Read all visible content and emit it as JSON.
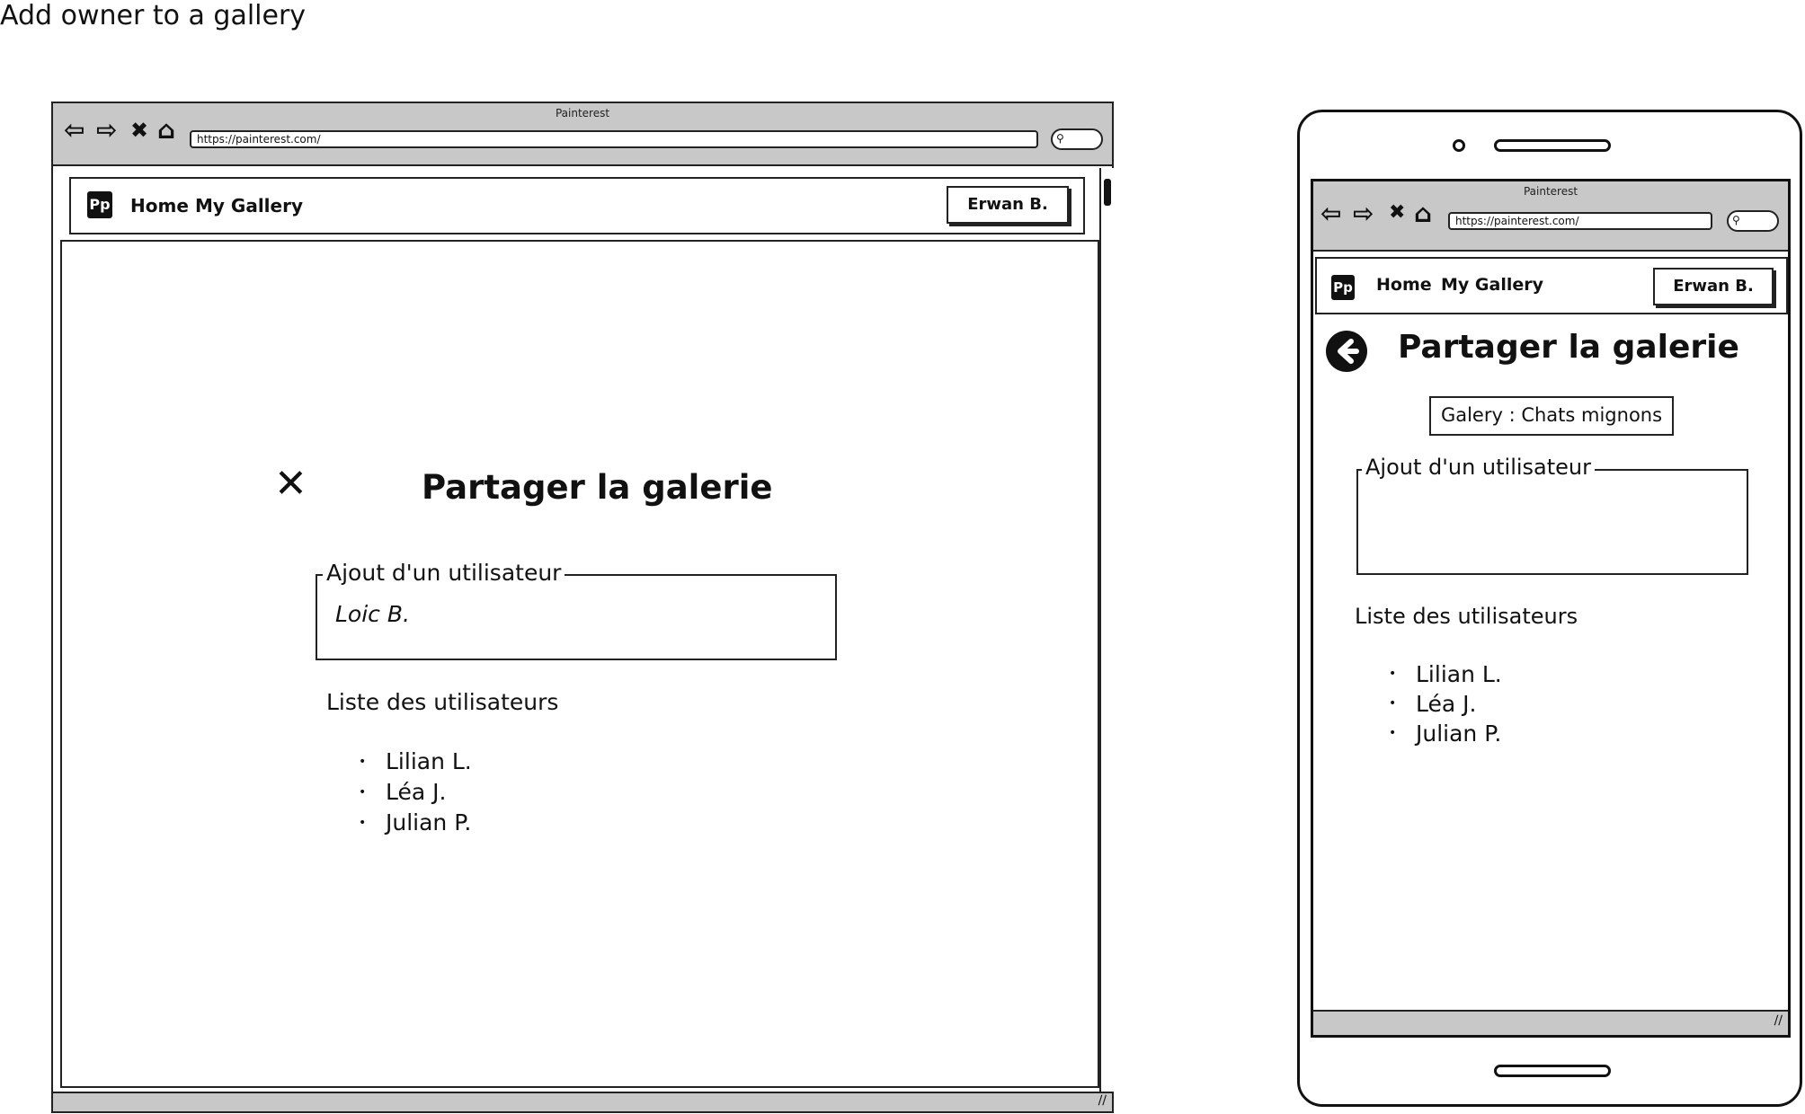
{
  "page": {
    "title": "Add owner to a gallery"
  },
  "browser": {
    "window_title": "Painterest",
    "url": "https://painterest.com/",
    "nav_icons": [
      "back-arrow-icon",
      "forward-arrow-icon",
      "close-x-icon",
      "home-icon"
    ],
    "search_icon": "search-icon"
  },
  "app": {
    "logo_text": "Pp",
    "nav": [
      {
        "label": "Home"
      },
      {
        "label": "My Gallery"
      }
    ],
    "user_button": "Erwan B."
  },
  "desktop": {
    "modal_title": "Partager la galerie",
    "close_symbol": "✕",
    "add_user": {
      "legend": "Ajout d'un utilisateur",
      "value": "Loic B."
    },
    "list_label": "Liste des utilisateurs",
    "users": [
      "Lilian L.",
      "Léa J.",
      "Julian P."
    ]
  },
  "mobile": {
    "title": "Partager la galerie",
    "gallery_badge": "Galery : Chats mignons",
    "add_user": {
      "legend": "Ajout d'un utilisateur",
      "value": ""
    },
    "list_label": "Liste des utilisateurs",
    "users": [
      "Lilian L.",
      "Léa J.",
      "Julian P."
    ]
  },
  "colors": {
    "chrome": "#c8c8c8",
    "ink": "#111111",
    "background": "#ffffff"
  }
}
